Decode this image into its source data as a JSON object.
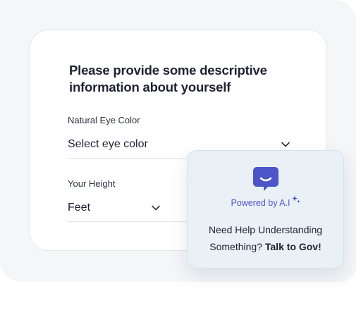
{
  "form": {
    "title": "Please provide some descriptive information about yourself",
    "eye_color": {
      "label": "Natural Eye Color",
      "placeholder": "Select eye color"
    },
    "height": {
      "label": "Your Height",
      "value": "Feet"
    }
  },
  "assistant": {
    "powered_by": "Powered by A.I",
    "help_line1": "Need Help Understanding",
    "help_line2_prefix": "Something?",
    "help_link": "Talk to Gov!"
  },
  "colors": {
    "accent": "#4c55c8",
    "assistant_bg": "#e9f1f7",
    "backdrop": "#f4f6f8"
  },
  "icons": {
    "assistant": "chat-bubble-smile-icon",
    "sparkle": "sparkle-icon",
    "dropdown": "chevron-down-icon"
  }
}
